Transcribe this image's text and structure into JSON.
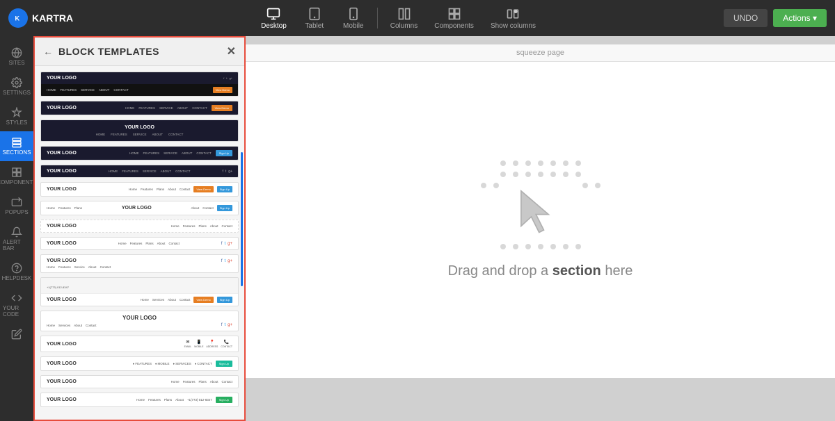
{
  "app": {
    "name": "KARTRA",
    "logo_text": "K"
  },
  "toolbar": {
    "undo_label": "UNDO",
    "actions_label": "Actions ▾",
    "views": [
      {
        "id": "desktop",
        "label": "Desktop"
      },
      {
        "id": "tablet",
        "label": "Tablet"
      },
      {
        "id": "mobile",
        "label": "Mobile"
      },
      {
        "id": "columns",
        "label": "Columns"
      },
      {
        "id": "components",
        "label": "Components"
      },
      {
        "id": "show_columns",
        "label": "Show columns"
      }
    ]
  },
  "sidebar": {
    "items": [
      {
        "id": "sites",
        "label": "SITES"
      },
      {
        "id": "settings",
        "label": "SETTINGS"
      },
      {
        "id": "styles",
        "label": "STYLES"
      },
      {
        "id": "sections",
        "label": "SECTIONS",
        "active": true
      },
      {
        "id": "components",
        "label": "COMPONENTS"
      },
      {
        "id": "popups",
        "label": "POPUPS"
      },
      {
        "id": "alert_bar",
        "label": "ALERT BAR"
      },
      {
        "id": "helpdesk",
        "label": "HELPDESK"
      },
      {
        "id": "your_code",
        "label": "YOUR CODE"
      },
      {
        "id": "edit",
        "label": ""
      }
    ]
  },
  "panel": {
    "title": "BLOCK TEMPLATES",
    "back_label": "←",
    "close_label": "✕"
  },
  "canvas": {
    "page_label": "squeeze page",
    "drop_text_prefix": "Drag and drop a ",
    "drop_text_bold": "section",
    "drop_text_suffix": " here"
  },
  "templates": [
    {
      "id": 1,
      "type": "dark-nav-social"
    },
    {
      "id": 2,
      "type": "dark-nav-orange-btn"
    },
    {
      "id": 3,
      "type": "dark-nav-only"
    },
    {
      "id": 4,
      "type": "dark-nav-blue-btn"
    },
    {
      "id": 5,
      "type": "dark-nav-social2"
    },
    {
      "id": 6,
      "type": "white-nav-orange"
    },
    {
      "id": 7,
      "type": "white-nav-blue"
    },
    {
      "id": 8,
      "type": "white-nav-minimal"
    },
    {
      "id": 9,
      "type": "white-nav-social"
    },
    {
      "id": 10,
      "type": "white-nav-social2"
    },
    {
      "id": 11,
      "type": "white-top-bar-nav"
    },
    {
      "id": 12,
      "type": "white-nav-logo-right"
    },
    {
      "id": 13,
      "type": "white-nav-icons"
    },
    {
      "id": 14,
      "type": "white-nav-teal"
    },
    {
      "id": 15,
      "type": "white-nav-icons2"
    },
    {
      "id": 16,
      "type": "white-nav-green"
    }
  ]
}
